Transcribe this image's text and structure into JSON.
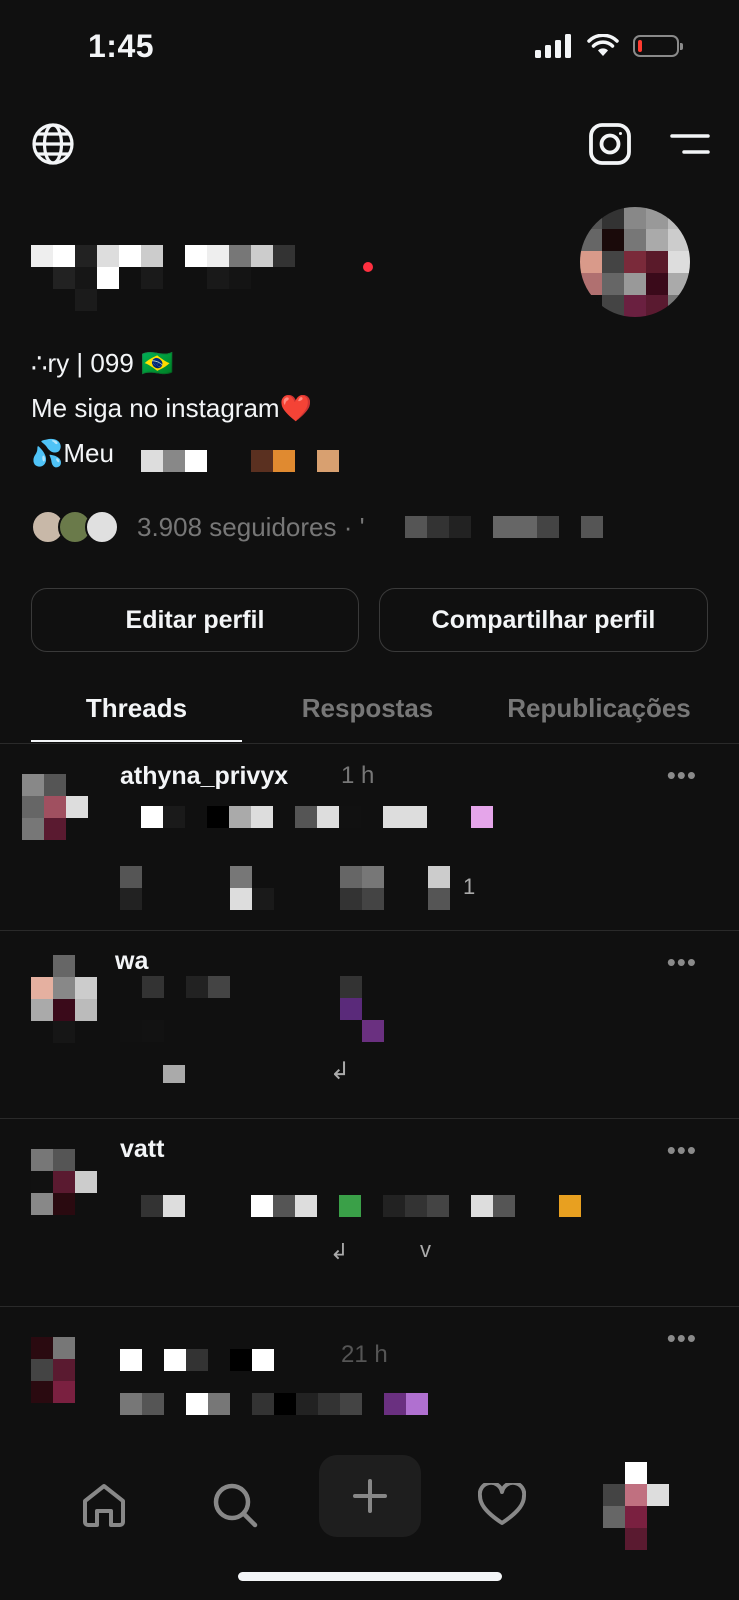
{
  "status_bar": {
    "time": "1:45"
  },
  "profile": {
    "bio": {
      "line1": "∴ry | 099 🇧🇷",
      "line2": "Me siga no instagram❤️",
      "line3": "💦Meu"
    },
    "followers_text": "3.908 seguidores · '"
  },
  "actions": {
    "edit": "Editar perfil",
    "share": "Compartilhar perfil"
  },
  "tabs": [
    {
      "label": "Threads",
      "active": true
    },
    {
      "label": "Respostas",
      "active": false
    },
    {
      "label": "Republicações",
      "active": false
    }
  ],
  "posts": [
    {
      "username": "athyna_privyx",
      "time": "1 h",
      "likes": "1",
      "more": "•••"
    },
    {
      "username": "wa",
      "time": "",
      "more": "•••"
    },
    {
      "username": "vatt",
      "time": "",
      "more": "•••"
    },
    {
      "username": "",
      "time": "21 h",
      "more": "•••"
    }
  ],
  "colors": {
    "background": "#101010",
    "text": "#f3f5f7",
    "muted": "#777777",
    "border": "#3a3a3a",
    "accent_red": "#ff3040"
  },
  "icons": {
    "globe": "globe-icon",
    "instagram": "instagram-icon",
    "menu": "menu-icon",
    "home": "home-icon",
    "search": "search-icon",
    "compose": "plus-icon",
    "activity": "heart-icon",
    "profile": "avatar"
  }
}
